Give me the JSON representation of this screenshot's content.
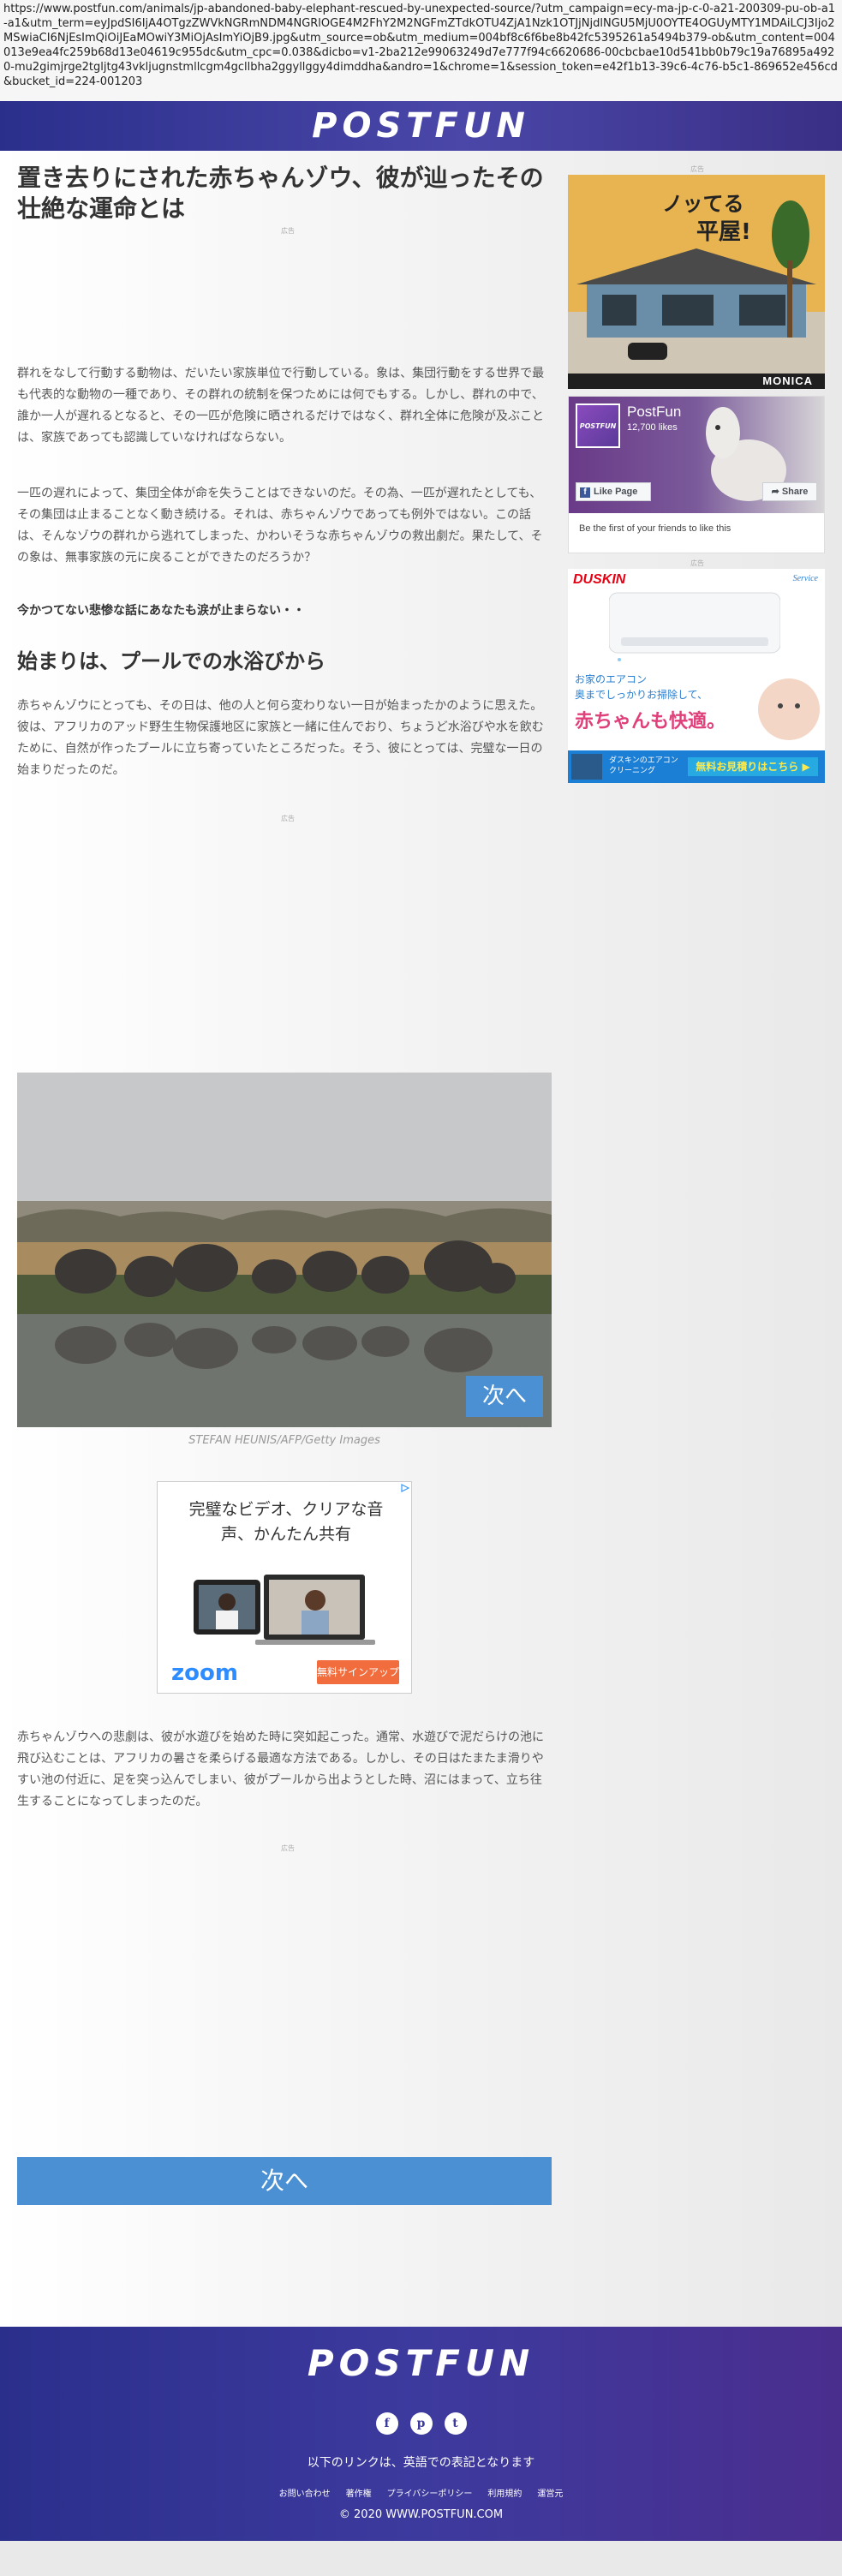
{
  "browser": {
    "url": "https://www.postfun.com/animals/jp-abandoned-baby-elephant-rescued-by-unexpected-source/?utm_campaign=ecy-ma-jp-c-0-a21-200309-pu-ob-a1-a1&utm_term=eyJpdSI6IjA4OTgzZWVkNGRmNDM4NGRlOGE4M2FhY2M2NGFmZTdkOTU4ZjA1Nzk1OTJjNjdlNGU5MjU0OYTE4OGUyMTY1MDAiLCJ3Ijo2MSwiaCI6NjEsImQiOiJEaMOwiY3MiOjAsImYiOjB9.jpg&utm_source=ob&utm_medium=004bf8c6f6be8b42fc5395261a5494b379-ob&utm_content=004013e9ea4fc259b68d13e04619c955dc&utm_cpc=0.038&dicbo=v1-2ba212e99063249d7e777f94c6620686-00cbcbae10d541bb0b79c19a76895a4920-mu2gimjrge2tgljtg43vkljugnstmllcgm4gcllbha2ggyllggy4dimddha&andro=1&chrome=1&session_token=e42f1b13-39c6-4c76-b5c1-869652e456cd&bucket_id=224-001203"
  },
  "header": {
    "logo": "POSTFUN"
  },
  "ad_label": "広告",
  "article": {
    "title": "置き去りにされた赤ちゃんゾウ、彼が辿ったその壮絶な運命とは",
    "para1": "群れをなして行動する動物は、だいたい家族単位で行動している。象は、集団行動をする世界で最も代表的な動物の一種であり、その群れの統制を保つためには何でもする。しかし、群れの中で、誰か一人が遅れるとなると、その一匹が危険に晒されるだけではなく、群れ全体に危険が及ぶことは、家族であっても認識していなければならない。",
    "para2": "一匹の遅れによって、集団全体が命を失うことはできないのだ。その為、一匹が遅れたとしても、その集団は止まることなく動き続ける。それは、赤ちゃんゾウであっても例外ではない。この話は、そんなゾウの群れから逃れてしまった、かわいそうな赤ちゃんゾウの救出劇だ。果たして、その象は、無事家族の元に戻ることができたのだろうか？",
    "teaser": "今かつてない悲惨な話にあなたも涙が止まらない・・",
    "section_heading": "始まりは、プールでの水浴びから",
    "para3": "赤ちゃんゾウにとっても、その日は、他の人と何ら変わりない一日が始まったかのように思えた。彼は、アフリカのアッド野生生物保護地区に家族と一緒に住んでおり、ちょうど水浴びや水を飲むために、自然が作ったプールに立ち寄っていたところだった。そう、彼にとっては、完璧な一日の始まりだったのだ。",
    "photo_next": "次へ",
    "photo_credit": "STEFAN HEUNIS/AFP/Getty Images",
    "para4": "赤ちゃんゾウへの悲劇は、彼が水遊びを始めた時に突如起こった。通常、水遊びで泥だらけの池に飛び込むことは、アフリカの暑さを柔らげる最適な方法である。しかし、その日はたまたま滑りやすい池の付近に、足を突っ込んでしまい、彼がプールから出ようとした時、沼にはまって、立ち往生することになってしまったのだ。",
    "next_button": "次へ"
  },
  "zoom_ad": {
    "headline": "完璧なビデオ、クリアな音声、かんたん共有",
    "logo": "zoom",
    "cta": "無料サインアップ"
  },
  "sidebar": {
    "house_ad": {
      "line1": "ノッてる",
      "line2": "平屋!",
      "brand": "MONICA"
    },
    "fb": {
      "page_name": "PostFun",
      "likes": "12,700 likes",
      "like_button": "Like Page",
      "share_button": "Share",
      "friends": "Be the first of your friends to like this",
      "thumb_text": "POSTFUN"
    },
    "duskin_ad": {
      "brand": "DUSKIN",
      "service": "Service",
      "line1": "お家のエアコン",
      "line2": "奥までしっかりお掃除して、",
      "line3": "赤ちゃんも快適。",
      "small": "ダスキンのエアコンクリーニング",
      "cta": "無料お見積りはこちら ▶"
    }
  },
  "footer": {
    "logo": "POSTFUN",
    "social": [
      "f",
      "p",
      "t"
    ],
    "note": "以下のリンクは、英語での表記となります",
    "links": [
      "お問い合わせ",
      "著作権",
      "プライバシーポリシー",
      "利用規約",
      "運営元"
    ],
    "copyright": "© 2020 WWW.POSTFUN.COM"
  }
}
